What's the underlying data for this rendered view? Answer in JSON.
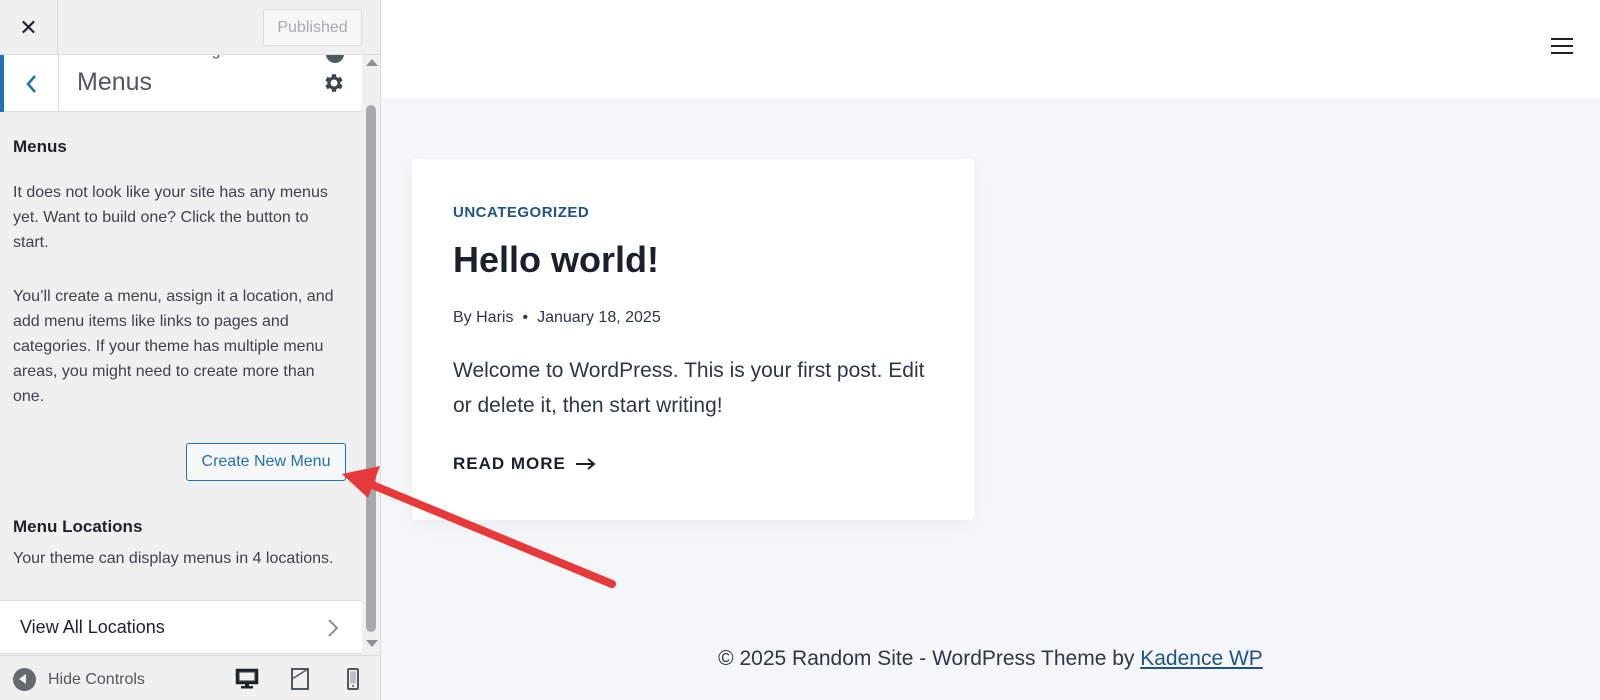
{
  "topbar": {
    "close_icon": "close-icon",
    "published_label": "Published"
  },
  "section": {
    "customizing_label": "You are customizing",
    "title": "Menus"
  },
  "panel": {
    "menus_heading": "Menus",
    "intro_text": "It does not look like your site has any menus yet. Want to build one? Click the button to start.",
    "detail_text": "You’ll create a menu, assign it a location, and add menu items like links to pages and categories. If your theme has multiple menu areas, you might need to create more than one.",
    "create_button": "Create New Menu",
    "locations_heading": "Menu Locations",
    "locations_text": "Your theme can display menus in 4 locations.",
    "view_all_label": "View All Locations"
  },
  "footer_controls": {
    "hide_label": "Hide Controls",
    "devices": [
      "desktop-icon",
      "tablet-icon",
      "mobile-icon"
    ]
  },
  "preview": {
    "post": {
      "category": "UNCATEGORIZED",
      "title": "Hello world!",
      "author": "By Haris",
      "date": "January 18, 2025",
      "excerpt": "Welcome to WordPress. This is your first post. Edit or delete it, then start writing!",
      "read_more": "READ MORE"
    },
    "footer": {
      "text": "© 2025 Random Site - WordPress Theme by ",
      "link": "Kadence WP"
    }
  },
  "colors": {
    "accent": "#2271b1",
    "category_link": "#215387",
    "annotation_arrow": "#e8393a"
  }
}
